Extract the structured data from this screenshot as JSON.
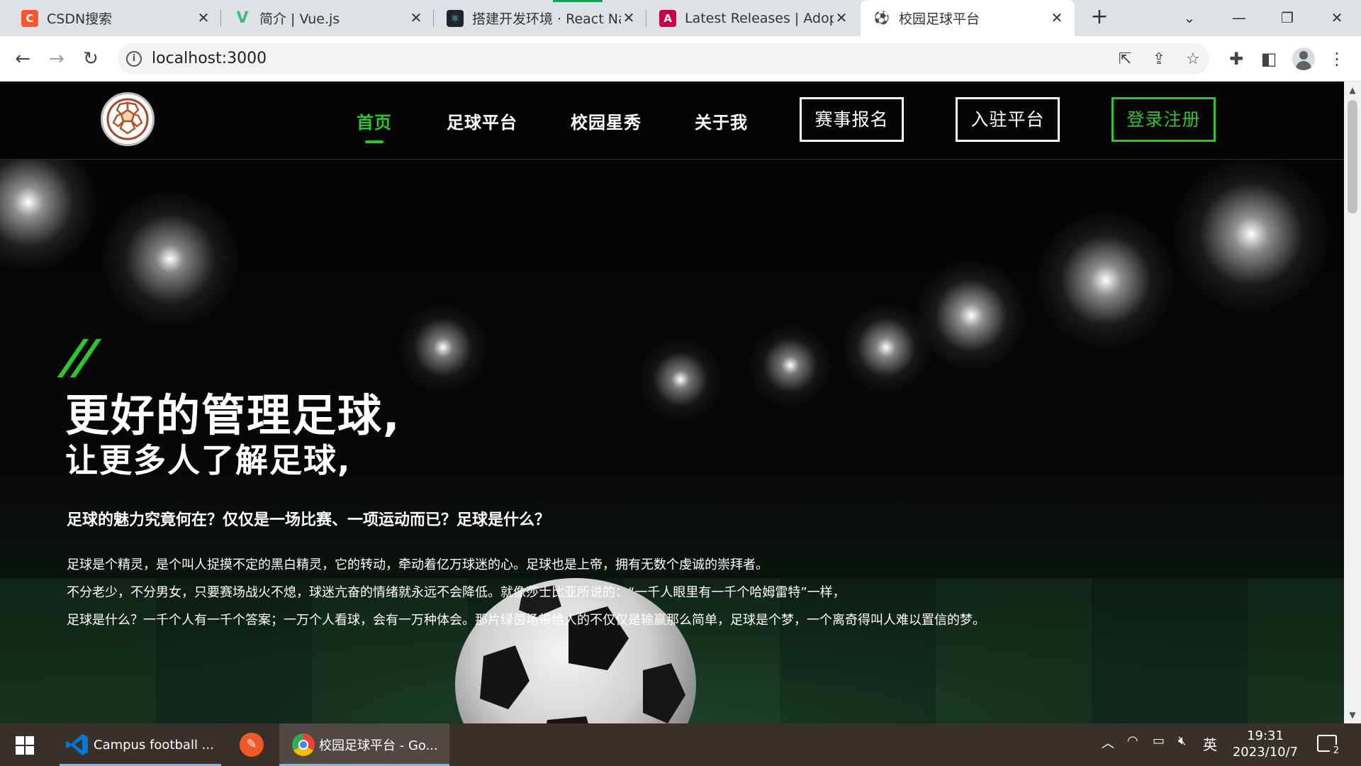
{
  "browser": {
    "tabs": [
      {
        "title": "CSDN搜索",
        "icon": "csdn-icon",
        "favicon_letter": "C",
        "color": "#fc5531"
      },
      {
        "title": "简介 | Vue.js",
        "icon": "vue-icon",
        "favicon_letter": "V",
        "color": "#42b883"
      },
      {
        "title": "搭建开发环境 · React Na",
        "icon": "react-icon",
        "favicon_letter": "⚛",
        "color": "#20232a"
      },
      {
        "title": "Latest Releases | Adopt",
        "icon": "adoptium-icon",
        "favicon_letter": "A",
        "color": "#c8004b"
      },
      {
        "title": "校园足球平台",
        "icon": "football-icon",
        "favicon_letter": "⚽",
        "color": "#ffffff"
      }
    ],
    "active_tab_index": 4,
    "url": "localhost:3000"
  },
  "site": {
    "nav": {
      "home": "首页",
      "platform": "足球平台",
      "stars": "校园星秀",
      "about": "关于我",
      "signup_event": "赛事报名",
      "join_platform": "入驻平台",
      "login_register": "登录注册"
    },
    "hero": {
      "quote_mark": "//",
      "headline": "更好的管理足球,",
      "subheadline": "让更多人了解足球,",
      "question": "足球的魅力究竟何在？仅仅是一场比赛、一项运动而已？足球是什么？",
      "paragraphs": [
        "足球是个精灵，是个叫人捉摸不定的黑白精灵，它的转动，牵动着亿万球迷的心。足球也是上帝，拥有无数个虔诚的崇拜者。",
        "不分老少，不分男女，只要赛场战火不熄，球迷亢奋的情绪就永远不会降低。就像莎士比亚所说的：“一千人眼里有一千个哈姆雷特”一样，",
        "足球是什么？一千个人有一千个答案；一万个人看球，会有一万种体会。那片绿茵场带给人的不仅仅是输赢那么简单，足球是个梦，一个离奇得叫人难以置信的梦。"
      ]
    },
    "accent_color": "#2ec52e"
  },
  "taskbar": {
    "apps": [
      {
        "label": "Campus football ...",
        "icon": "vscode-icon"
      },
      {
        "label": "",
        "icon": "pen-app-icon"
      },
      {
        "label": "校园足球平台 - Go...",
        "icon": "chrome-icon"
      }
    ],
    "ime": "英",
    "time": "19:31",
    "date": "2023/10/7",
    "notification_count": "2"
  }
}
